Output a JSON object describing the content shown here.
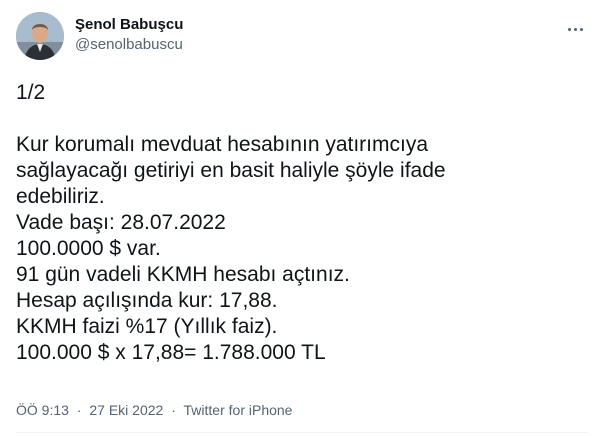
{
  "author": {
    "display_name": "Şenol Babuşcu",
    "handle": "@senolbabuscu",
    "avatar_icon": "profile-photo-icon"
  },
  "more_icon": "more-options-icon",
  "tweet": {
    "lines": [
      "1/2",
      "",
      "Kur korumalı mevduat hesabının yatırımcıya",
      "sağlayacağı getiriyi en basit haliyle şöyle ifade",
      "edebiliriz.",
      "Vade başı: 28.07.2022",
      "100.0000 $ var.",
      "91 gün vadeli KKMH hesabı açtınız.",
      "Hesap açılışında kur: 17,88.",
      "KKMH faizi %17 (Yıllık faiz).",
      "100.000 $ x 17,88= 1.788.000 TL"
    ]
  },
  "meta": {
    "time": "ÖÖ 9:13",
    "date": "27 Eki 2022",
    "source": "Twitter for iPhone",
    "separator": "·"
  },
  "colors": {
    "text": "#0f1419",
    "secondary": "#536471",
    "divider": "#eff3f4"
  }
}
